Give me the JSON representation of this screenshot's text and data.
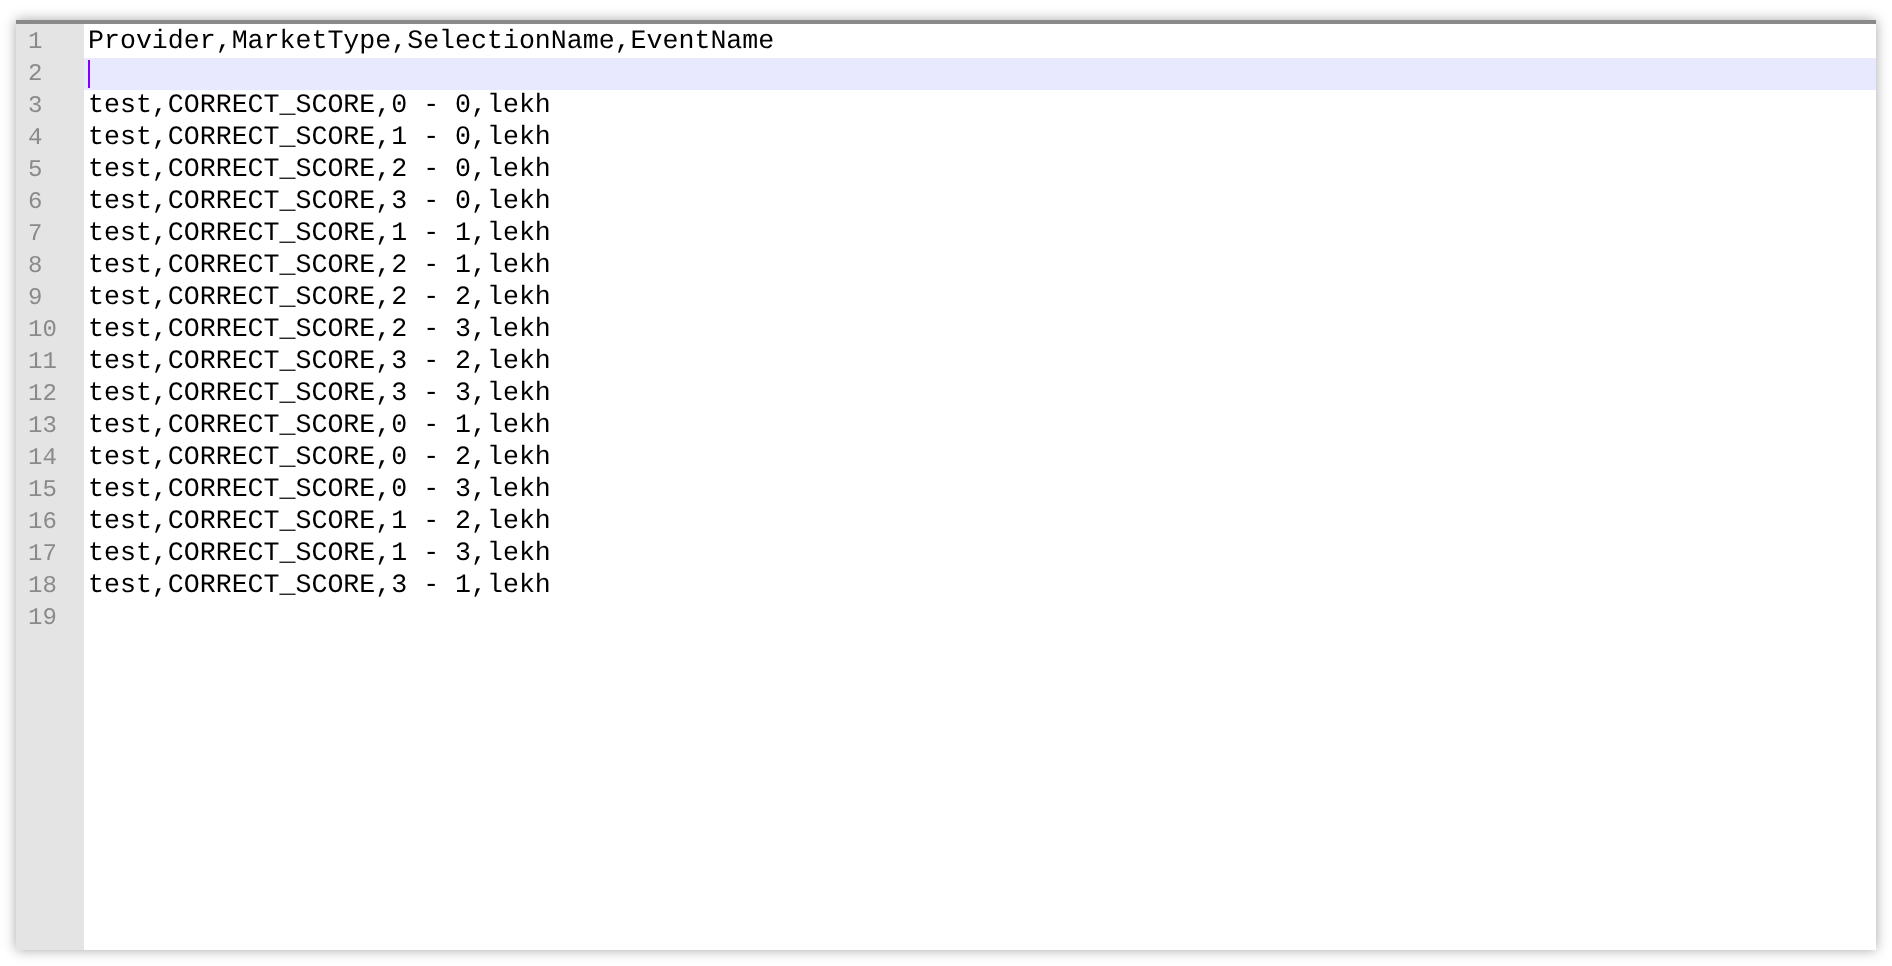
{
  "editor": {
    "lines": [
      {
        "number": "1",
        "text": "Provider,MarketType,SelectionName,EventName",
        "current": false
      },
      {
        "number": "2",
        "current": true
      },
      {
        "number": "3",
        "text": "test,CORRECT_SCORE,0 - 0,lekh",
        "current": false
      },
      {
        "number": "4",
        "text": "test,CORRECT_SCORE,1 - 0,lekh",
        "current": false
      },
      {
        "number": "5",
        "text": "test,CORRECT_SCORE,2 - 0,lekh",
        "current": false
      },
      {
        "number": "6",
        "text": "test,CORRECT_SCORE,3 - 0,lekh",
        "current": false
      },
      {
        "number": "7",
        "text": "test,CORRECT_SCORE,1 - 1,lekh",
        "current": false
      },
      {
        "number": "8",
        "text": "test,CORRECT_SCORE,2 - 1,lekh",
        "current": false
      },
      {
        "number": "9",
        "text": "test,CORRECT_SCORE,2 - 2,lekh",
        "current": false
      },
      {
        "number": "10",
        "text": "test,CORRECT_SCORE,2 - 3,lekh",
        "current": false
      },
      {
        "number": "11",
        "text": "test,CORRECT_SCORE,3 - 2,lekh",
        "current": false
      },
      {
        "number": "12",
        "text": "test,CORRECT_SCORE,3 - 3,lekh",
        "current": false
      },
      {
        "number": "13",
        "text": "test,CORRECT_SCORE,0 - 1,lekh",
        "current": false
      },
      {
        "number": "14",
        "text": "test,CORRECT_SCORE,0 - 2,lekh",
        "current": false
      },
      {
        "number": "15",
        "text": "test,CORRECT_SCORE,0 - 3,lekh",
        "current": false
      },
      {
        "number": "16",
        "text": "test,CORRECT_SCORE,1 - 2,lekh",
        "current": false
      },
      {
        "number": "17",
        "text": "test,CORRECT_SCORE,1 - 3,lekh",
        "current": false
      },
      {
        "number": "18",
        "text": "test,CORRECT_SCORE,3 - 1,lekh",
        "current": false
      },
      {
        "number": "19",
        "current": false
      }
    ]
  }
}
